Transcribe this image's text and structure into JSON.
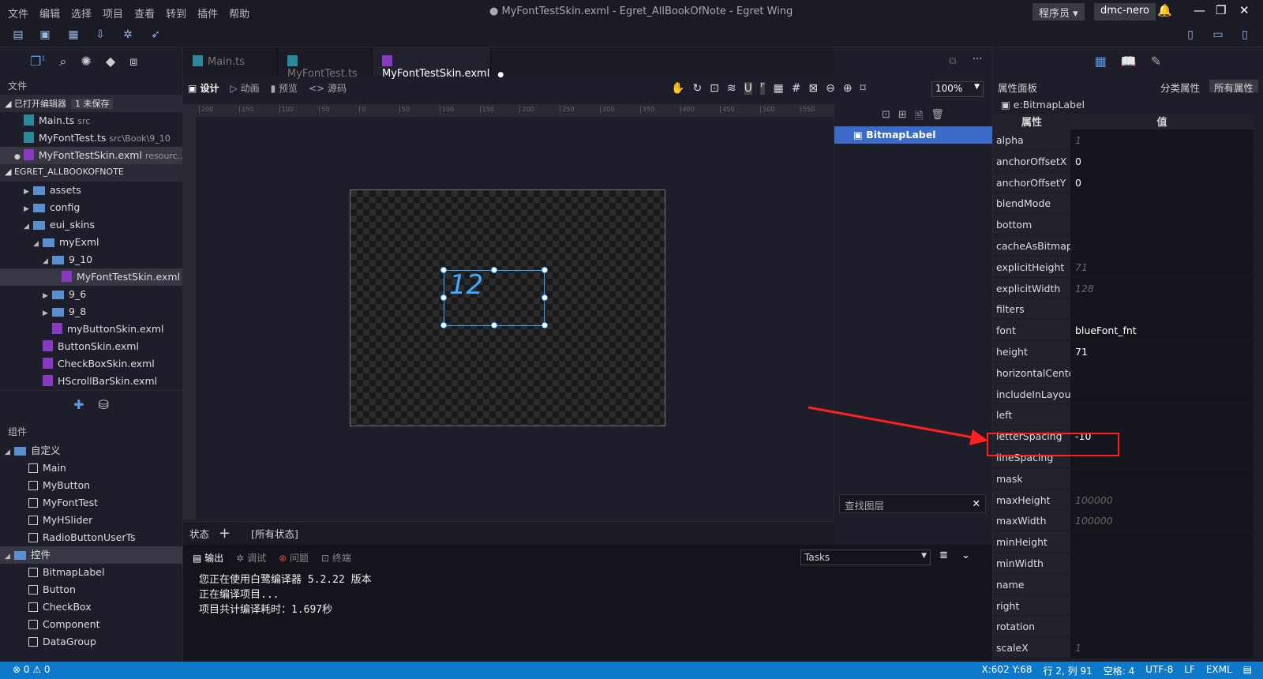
{
  "menu": [
    "文件",
    "编辑",
    "选择",
    "项目",
    "查看",
    "转到",
    "插件",
    "帮助"
  ],
  "window_title": "● MyFontTestSkin.exml - Egret_AllBookOfNote - Egret Wing",
  "role": "程序员",
  "user": "dmc-nero",
  "activity_badge": "1",
  "sidebar": {
    "section": "文件",
    "open_editors": "已打开编辑器",
    "unsaved": "1 未保存",
    "open_files": [
      {
        "name": "Main.ts",
        "desc": "src"
      },
      {
        "name": "MyFontTest.ts",
        "desc": "src\\Book\\9_10"
      },
      {
        "name": "MyFontTestSkin.exml",
        "desc": "resourc..."
      }
    ],
    "project": "EGRET_ALLBOOKOFNOTE",
    "tree": [
      {
        "name": "assets",
        "type": "folder",
        "level": 1
      },
      {
        "name": "config",
        "type": "folder",
        "level": 1
      },
      {
        "name": "eui_skins",
        "type": "folder",
        "level": 1
      },
      {
        "name": "myExml",
        "type": "folder",
        "level": 2
      },
      {
        "name": "9_10",
        "type": "folder",
        "level": 3
      },
      {
        "name": "MyFontTestSkin.exml",
        "type": "exml",
        "level": 4
      },
      {
        "name": "9_6",
        "type": "folder",
        "level": 3
      },
      {
        "name": "9_8",
        "type": "folder",
        "level": 3
      },
      {
        "name": "myButtonSkin.exml",
        "type": "exml",
        "level": 3
      },
      {
        "name": "ButtonSkin.exml",
        "type": "exml",
        "level": 2
      },
      {
        "name": "CheckBoxSkin.exml",
        "type": "exml",
        "level": 2
      },
      {
        "name": "HScrollBarSkin.exml",
        "type": "exml",
        "level": 2
      }
    ],
    "components_title": "组件",
    "custom": "自定义",
    "custom_items": [
      "Main",
      "MyButton",
      "MyFontTest",
      "MyHSlider",
      "RadioButtonUserTs"
    ],
    "controls": "控件",
    "control_items": [
      "BitmapLabel",
      "Button",
      "CheckBox",
      "Component",
      "DataGroup"
    ]
  },
  "tabs": [
    "Main.ts",
    "MyFontTest.ts",
    "MyFontTestSkin.exml"
  ],
  "modes": [
    "设计",
    "动画",
    "预览",
    "<> 源码"
  ],
  "zoom": "100%",
  "ruler": [
    "200",
    "150",
    "100",
    "50",
    "0",
    "50",
    "100",
    "150",
    "200",
    "250",
    "300",
    "350",
    "400",
    "450",
    "500",
    "550"
  ],
  "label_text": "12",
  "layers": {
    "item": "BitmapLabel",
    "search_placeholder": "查找图层"
  },
  "states": {
    "label": "状态",
    "add": "+",
    "all": "[所有状态]"
  },
  "output": {
    "tabs": [
      "输出",
      "调试",
      "问题",
      "终端"
    ],
    "tasks": "Tasks",
    "lines": [
      "您正在使用白鹭编译器 5.2.22 版本",
      "正在编译项目...",
      "项目共计编译耗时：1.697秒"
    ]
  },
  "props": {
    "title": "属性面板",
    "categorized": "分类属性",
    "all": "所有属性",
    "target": "e:BitmapLabel",
    "col_name": "属性",
    "col_value": "值",
    "rows": [
      {
        "n": "alpha",
        "v": "1",
        "ph": true
      },
      {
        "n": "anchorOffsetX",
        "v": "0"
      },
      {
        "n": "anchorOffsetY",
        "v": "0"
      },
      {
        "n": "blendMode",
        "v": ""
      },
      {
        "n": "bottom",
        "v": ""
      },
      {
        "n": "cacheAsBitmap",
        "v": ""
      },
      {
        "n": "explicitHeight",
        "v": "71",
        "ph": true
      },
      {
        "n": "explicitWidth",
        "v": "128",
        "ph": true
      },
      {
        "n": "filters",
        "v": ""
      },
      {
        "n": "font",
        "v": "blueFont_fnt"
      },
      {
        "n": "height",
        "v": "71"
      },
      {
        "n": "horizontalCenter",
        "v": ""
      },
      {
        "n": "includeInLayout",
        "v": ""
      },
      {
        "n": "left",
        "v": ""
      },
      {
        "n": "letterSpacing",
        "v": "-10"
      },
      {
        "n": "lineSpacing",
        "v": ""
      },
      {
        "n": "mask",
        "v": ""
      },
      {
        "n": "maxHeight",
        "v": "100000",
        "ph": true
      },
      {
        "n": "maxWidth",
        "v": "100000",
        "ph": true
      },
      {
        "n": "minHeight",
        "v": ""
      },
      {
        "n": "minWidth",
        "v": ""
      },
      {
        "n": "name",
        "v": ""
      },
      {
        "n": "right",
        "v": ""
      },
      {
        "n": "rotation",
        "v": ""
      },
      {
        "n": "scaleX",
        "v": "1",
        "ph": true
      }
    ]
  },
  "status": {
    "errors": "0",
    "warnings": "0",
    "coords": "X:602 Y:68",
    "pos": "行 2, 列 91",
    "spaces": "空格: 4",
    "enc": "UTF-8",
    "eol": "LF",
    "lang": "EXML"
  },
  "colors": {
    "accent": "#3a6bc8",
    "status": "#0e79c8",
    "highlight": "#ff2020",
    "selection": "#3fa8ff"
  }
}
